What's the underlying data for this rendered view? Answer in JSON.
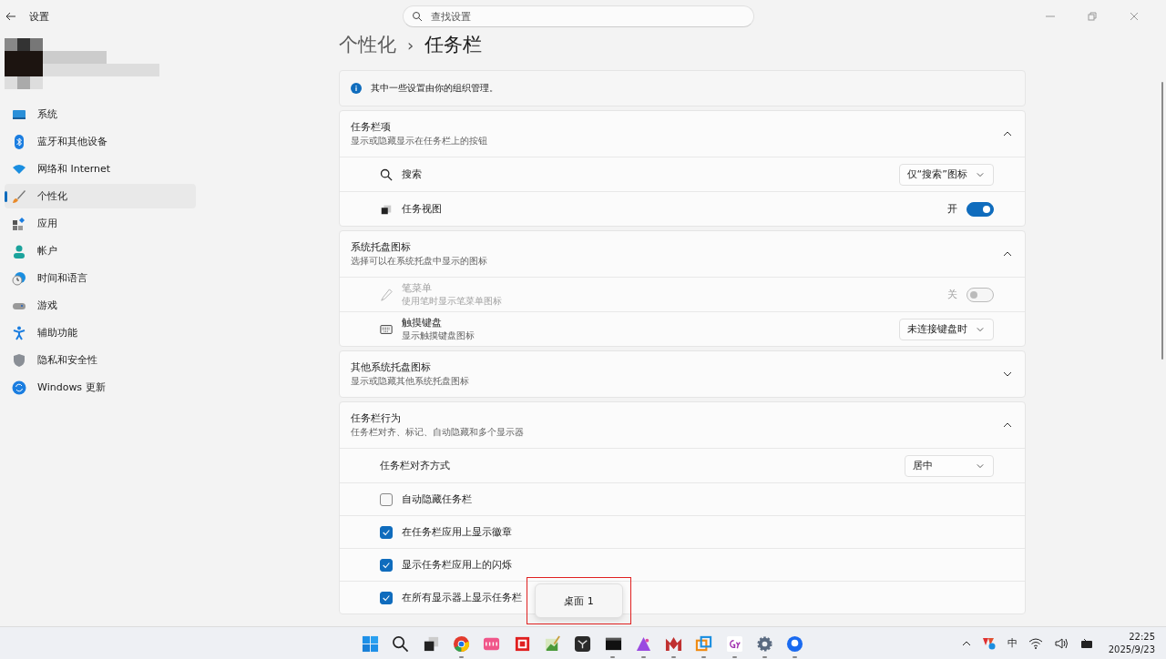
{
  "window": {
    "title": "设置",
    "search_placeholder": "查找设置"
  },
  "sidebar": {
    "items": [
      {
        "label": "系统",
        "selected": false
      },
      {
        "label": "蓝牙和其他设备",
        "selected": false
      },
      {
        "label": "网络和 Internet",
        "selected": false
      },
      {
        "label": "个性化",
        "selected": true
      },
      {
        "label": "应用",
        "selected": false
      },
      {
        "label": "帐户",
        "selected": false
      },
      {
        "label": "时间和语言",
        "selected": false
      },
      {
        "label": "游戏",
        "selected": false
      },
      {
        "label": "辅助功能",
        "selected": false
      },
      {
        "label": "隐私和安全性",
        "selected": false
      },
      {
        "label": "Windows 更新",
        "selected": false
      }
    ]
  },
  "breadcrumb": {
    "parent": "个性化",
    "separator": "›",
    "current": "任务栏"
  },
  "notice": "其中一些设置由你的组织管理。",
  "sections": [
    {
      "title": "任务栏项",
      "subtitle": "显示或隐藏显示在任务栏上的按钮",
      "expanded": true,
      "rows": [
        {
          "kind": "dropdown",
          "label": "搜索",
          "value": "仅“搜索”图标",
          "disabled": false
        },
        {
          "kind": "toggle",
          "label": "任务视图",
          "state_label": "开",
          "on": true,
          "disabled": false
        }
      ]
    },
    {
      "title": "系统托盘图标",
      "subtitle": "选择可以在系统托盘中显示的图标",
      "expanded": true,
      "rows": [
        {
          "kind": "toggle",
          "label": "笔菜单",
          "description": "使用笔时显示笔菜单图标",
          "state_label": "关",
          "on": false,
          "disabled": true
        },
        {
          "kind": "dropdown",
          "label": "触摸键盘",
          "description": "显示触摸键盘图标",
          "value": "未连接键盘时",
          "disabled": false
        }
      ]
    },
    {
      "title": "其他系统托盘图标",
      "subtitle": "显示或隐藏其他系统托盘图标",
      "expanded": false
    },
    {
      "title": "任务栏行为",
      "subtitle": "任务栏对齐、标记、自动隐藏和多个显示器",
      "expanded": true,
      "rows": [
        {
          "kind": "dropdown",
          "label": "任务栏对齐方式",
          "value": "居中",
          "disabled": false
        },
        {
          "kind": "checkbox",
          "label": "自动隐藏任务栏",
          "checked": false
        },
        {
          "kind": "checkbox",
          "label": "在任务栏应用上显示徽章",
          "checked": true
        },
        {
          "kind": "checkbox",
          "label": "显示任务栏应用上的闪烁",
          "checked": true
        },
        {
          "kind": "checkbox",
          "label": "在所有显示器上显示任务栏",
          "checked": true
        }
      ]
    }
  ],
  "tooltip": "桌面 1",
  "taskbar": {
    "apps": [
      {
        "running": false
      },
      {
        "running": false
      },
      {
        "running": false
      },
      {
        "running": true
      },
      {
        "running": false
      },
      {
        "running": false
      },
      {
        "running": false
      },
      {
        "running": false
      },
      {
        "running": true
      },
      {
        "running": true
      },
      {
        "running": true
      },
      {
        "running": true
      },
      {
        "running": true
      },
      {
        "running": true
      },
      {
        "running": true
      }
    ],
    "ime": "中",
    "time": "22:25",
    "date": "2025/9/23"
  }
}
